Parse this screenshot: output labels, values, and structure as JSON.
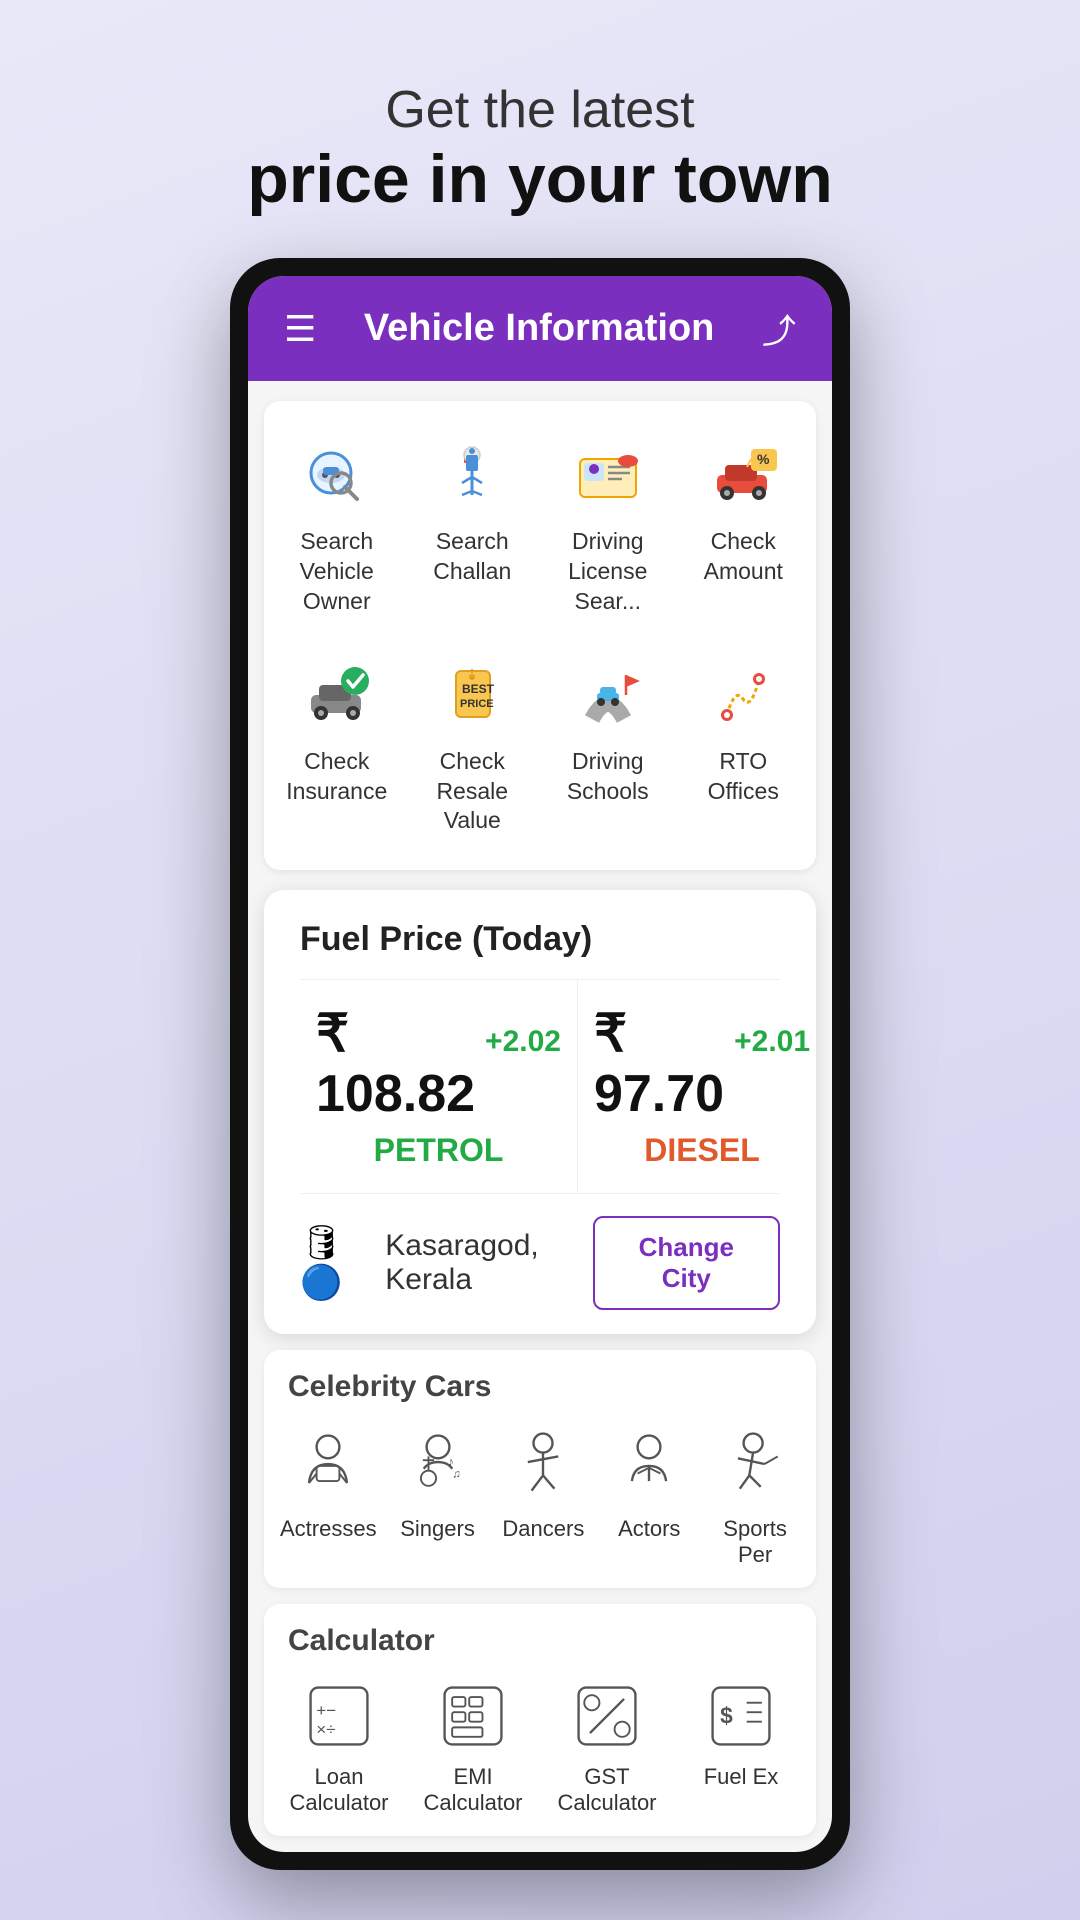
{
  "hero": {
    "subtitle": "Get the latest",
    "title": "price in your town"
  },
  "app": {
    "header_title": "Vehicle Information",
    "menu_label": "☰",
    "share_label": "⤴"
  },
  "vehicle_grid": {
    "items": [
      {
        "id": "search-vehicle-owner",
        "label": "Search Vehicle Owner",
        "icon": "search-car"
      },
      {
        "id": "search-challan",
        "label": "Search Challan",
        "icon": "challan"
      },
      {
        "id": "driving-license",
        "label": "Driving License Sear...",
        "icon": "license"
      },
      {
        "id": "check-amount",
        "label": "Check Amount",
        "icon": "loan"
      },
      {
        "id": "check-insurance",
        "label": "Check Insurance",
        "icon": "insurance"
      },
      {
        "id": "check-resale",
        "label": "Check Resale Value",
        "icon": "resale"
      },
      {
        "id": "driving-schools",
        "label": "Driving Schools",
        "icon": "driving-school"
      },
      {
        "id": "rto-offices",
        "label": "RTO Offices",
        "icon": "rto"
      }
    ]
  },
  "fuel": {
    "title": "Fuel Price (Today)",
    "petrol": {
      "amount": "₹ 108.82",
      "change": "+2.02",
      "label": "PETROL"
    },
    "diesel": {
      "amount": "₹ 97.70",
      "change": "+2.01",
      "label": "DIESEL"
    },
    "city": "Kasaragod, Kerala",
    "change_city_btn": "Change City"
  },
  "celebrity": {
    "section_title": "Celebrity Cars",
    "items": [
      {
        "id": "actresses",
        "label": "Actresses"
      },
      {
        "id": "singers",
        "label": "Singers"
      },
      {
        "id": "dancers",
        "label": "Dancers"
      },
      {
        "id": "actors",
        "label": "Actors"
      },
      {
        "id": "sports-persons",
        "label": "Sports Per"
      }
    ]
  },
  "calculator": {
    "section_title": "Calculator",
    "items": [
      {
        "id": "loan-calculator",
        "label": "Loan Calculator"
      },
      {
        "id": "emi-calculator",
        "label": "EMI Calculator"
      },
      {
        "id": "gst-calculator",
        "label": "GST Calculator"
      },
      {
        "id": "fuel-ex",
        "label": "Fuel Ex"
      }
    ]
  }
}
